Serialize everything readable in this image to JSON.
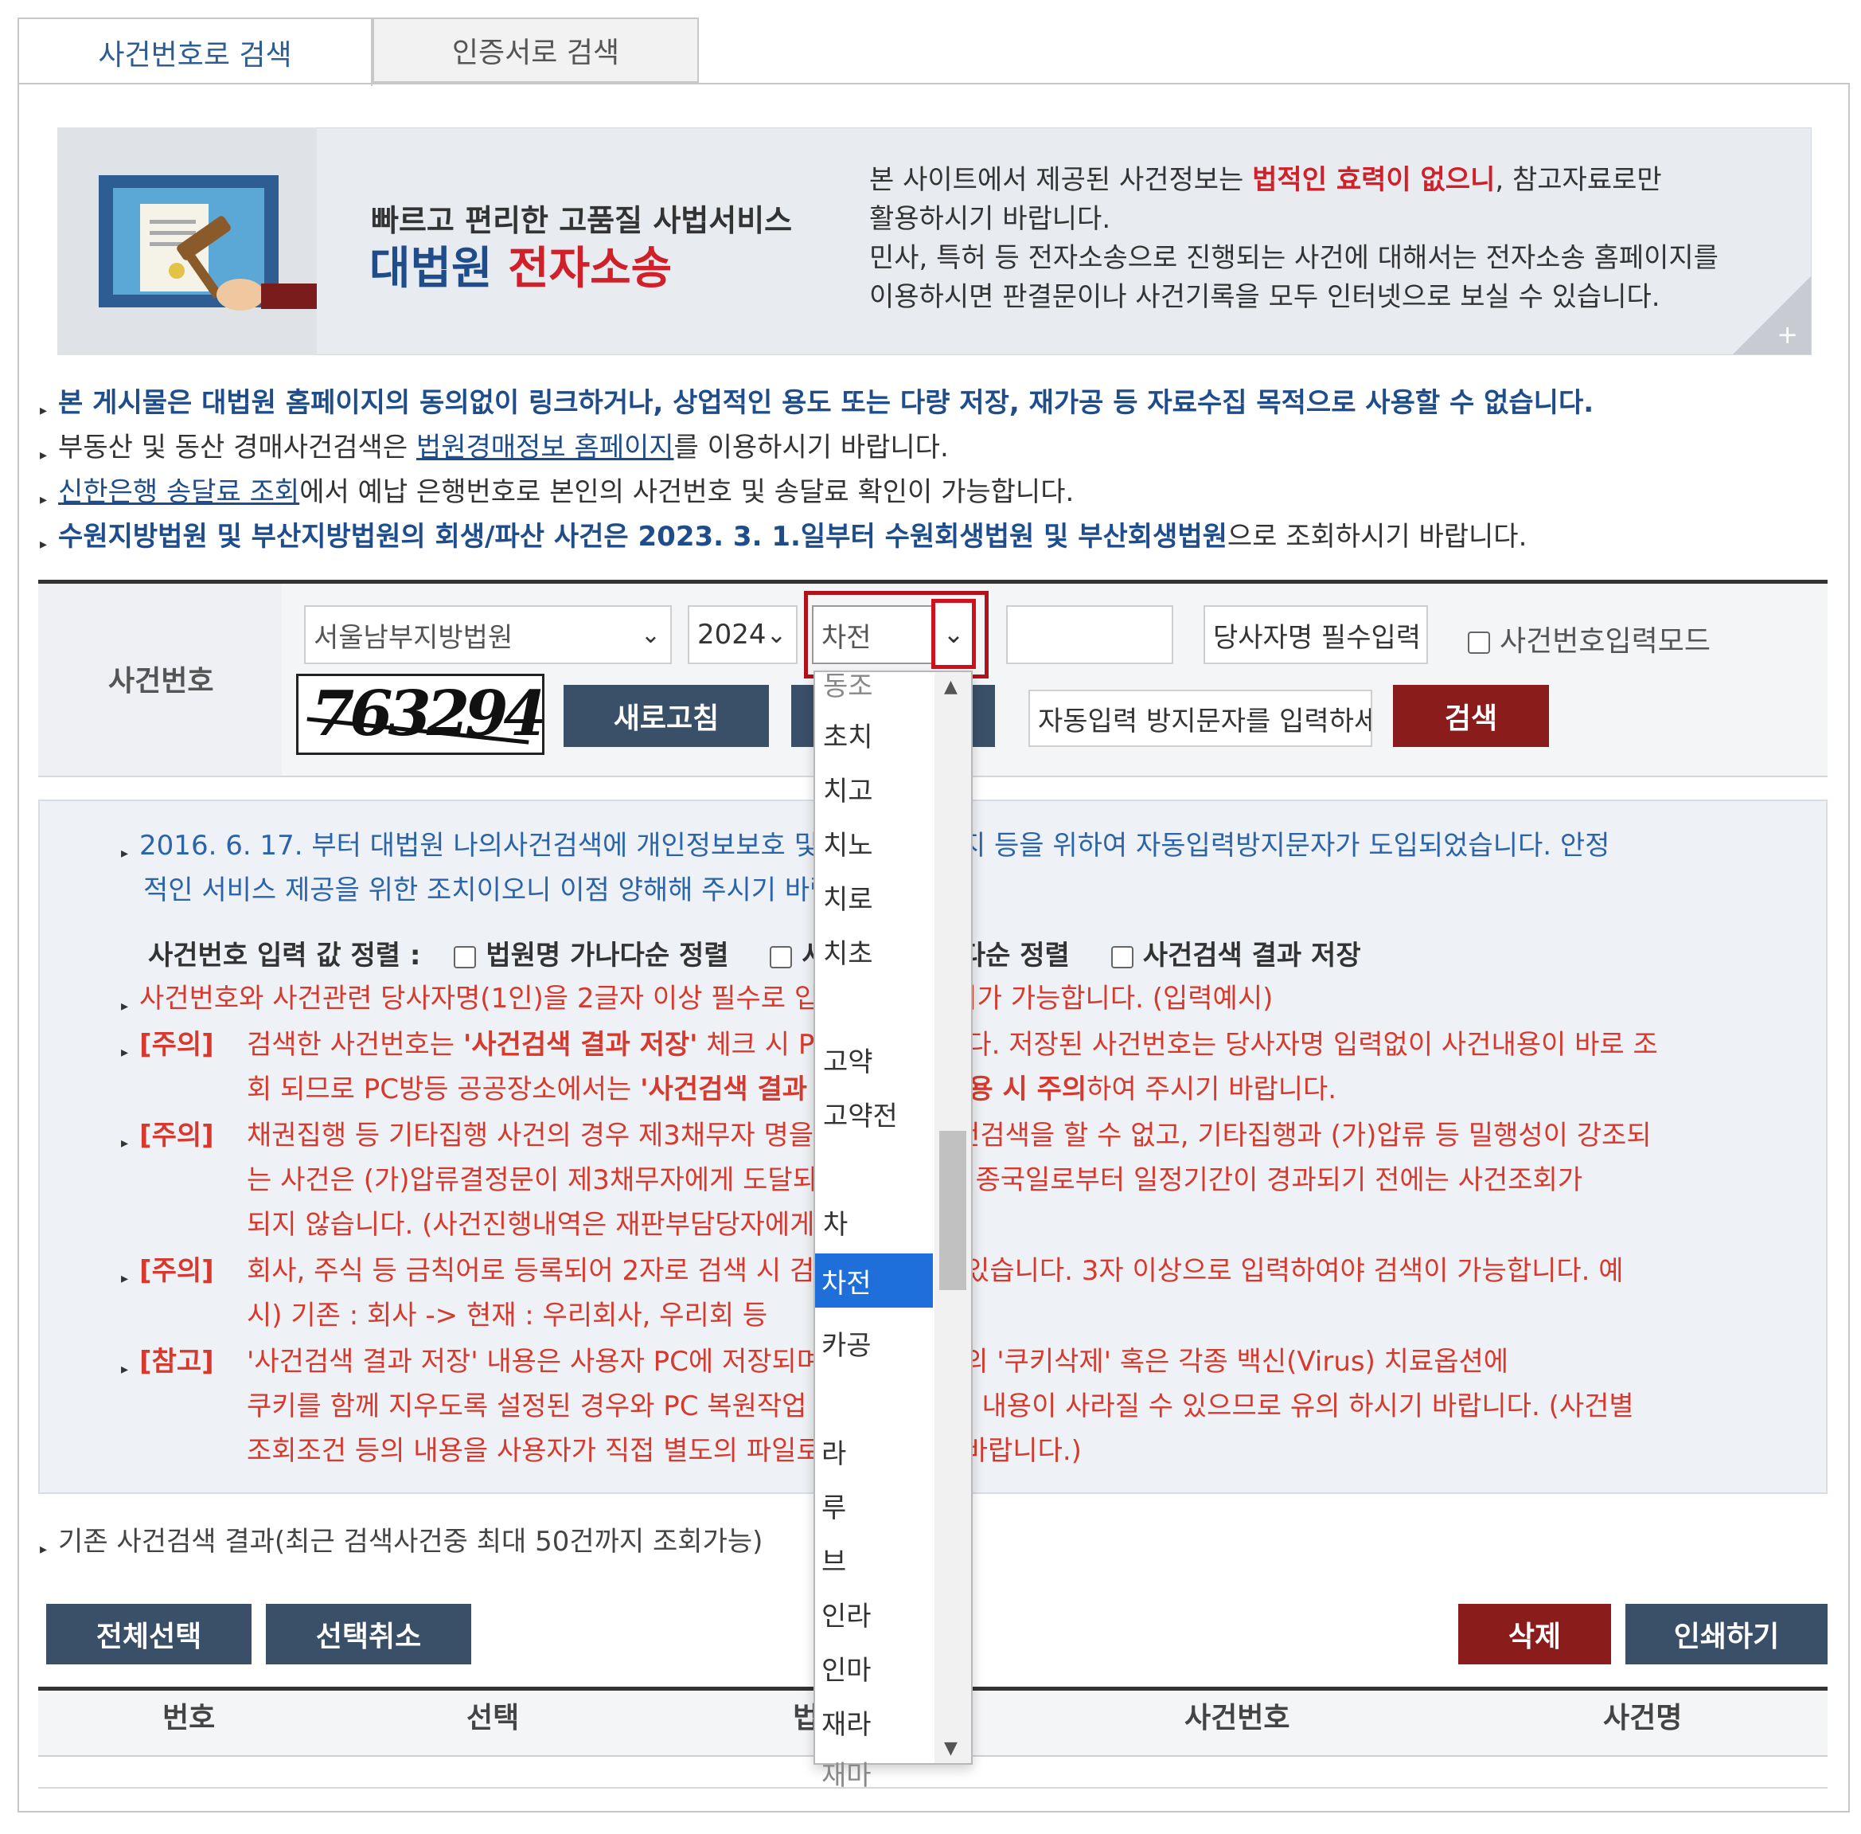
{
  "tabs": [
    {
      "label": "사건번호로 검색"
    },
    {
      "label": "인증서로 검색"
    }
  ],
  "banner": {
    "tagline": "빠르고 편리한 고품질 사법서비스",
    "brand_main": "대법원",
    "brand_accent": "전자소송",
    "text1_a": "본 사이트에서 제공된 사건정보는 ",
    "text1_red": "법적인 효력이 없으니",
    "text1_b": ", 참고자료로만",
    "text2": "활용하시기 바랍니다.",
    "text3": "민사, 특허 등 전자소송으로 진행되는 사건에 대해서는 전자소송 홈페이지를",
    "text4": "이용하시면 판결문이나 사건기록을 모두 인터넷으로 보실 수 있습니다.",
    "plus": "+"
  },
  "notices": {
    "n1": "본 게시물은 대법원 홈페이지의 동의없이 링크하거나, 상업적인 용도 또는 다량 저장, 재가공 등 자료수집 목적으로 사용할 수 없습니다.",
    "n2_a": "부동산 및 동산 경매사건검색은 ",
    "n2_link": "법원경매정보 홈페이지",
    "n2_b": "를 이용하시기 바랍니다.",
    "n3_link": "신한은행 송달료 조회",
    "n3_b": "에서 예납 은행번호로 본인의 사건번호 및 송달료 확인이 가능합니다.",
    "n4_a": "수원지방법원 및 부산지방법원의 회생/파산 사건은 2023. 3. 1.일부터 수원회생법원 및 부산회생법원",
    "n4_b": "으로 조회하시기 바랍니다."
  },
  "search": {
    "label": "사건번호",
    "court": "서울남부지방법원",
    "year": "2024",
    "case_type": "차전",
    "case_number": "",
    "party_placeholder": "당사자명 필수입력",
    "input_mode_label": "사건번호입력모드",
    "captcha_text": "763294",
    "refresh_label": "새로고침",
    "captcha_placeholder": "자동입력 방지문자를 입력하세요",
    "search_label": "검색"
  },
  "info": {
    "line1": "2016. 6. 17. 부터 대법원 나의사건검색에 개인정보보호 및 무단수집 방지 등을 위하여 자동입력방지문자가 도입되었습니다. 안정",
    "line2": "적인 서비스 제공을 위한 조치이오니 이점 양해해 주시기 바랍니다.",
    "sort_label": "사건번호 입력 값 정렬 :",
    "sort_opt1": "법원명 가나다순 정렬",
    "sort_opt2": "사건번호 가나다순 정렬",
    "sort_opt3": "사건검색 결과 저장",
    "red1": "사건번호와 사건관련 당사자명(1인)을 2글자 이상 필수로 입력하셔야 조회가 가능합니다. (입력예시)",
    "tag_note": "[주의]",
    "tag_ref": "[참고]",
    "c1_l1_a": "검색한 사건번호는 ",
    "c1_l1_b": "'사건검색 결과 저장'",
    "c1_l1_c": " 체크 시 PC에 저장됩니다. 저장된 사건번호는 당사자명 입력없이 사건내용이 바로 조",
    "c1_l2_a": "회 되므로 PC방등 공공장소에서는 ",
    "c1_l2_b": "'사건검색 결과 저장' 기능 사용 시 주의",
    "c1_l2_c": "하여 주시기 바랍니다.",
    "c2_l1": "채권집행 등 기타집행 사건의 경우 제3채무자 명을 입력하여 사건검색을 할 수 없고, 기타집행과 (가)압류 등 밀행성이 강조되",
    "c2_l2": "는 사건은 (가)압류결정문이 제3채무자에게 도달되었다거나 사건종국일로부터 일정기간이 경과되기 전에는 사건조회가",
    "c2_l3": "되지 않습니다. (사건진행내역은 재판부담당자에게 문의)",
    "c3_l1": "회사, 주식 등 금칙어로 등록되어 2자로 검색 시 검색이 안될 수 있습니다. 3자 이상으로 입력하여야 검색이 가능합니다. 예",
    "c3_l2": "시) 기존 : 회사 -> 현재 : 우리회사, 우리회 등",
    "c4_l1": "'사건검색 결과 저장' 내용은 사용자 PC에 저장되며 인터넷 옵션의 '쿠키삭제' 혹은 각종 백신(Virus) 치료옵션에",
    "c4_l2": "쿠키를 함께 지우도록 설정된 경우와 PC 복원작업 등으로 저장된 내용이 사라질 수 있으므로 유의 하시기 바랍니다. (사건별",
    "c4_l3": "조회조건 등의 내용을 사용자가 직접 별도의 파일로 관리하시기 바랍니다.)"
  },
  "history": {
    "title": "기존 사건검색 결과(최근 검색사건중 최대 50건까지 조회가능)",
    "select_all": "전체선택",
    "deselect": "선택취소",
    "delete": "삭제",
    "print": "인쇄하기",
    "columns": [
      "번호",
      "선택",
      "법원",
      "사건번호",
      "사건명"
    ]
  },
  "dropdown": {
    "options": [
      "동조",
      "초치",
      "치고",
      "치노",
      "치로",
      "치초",
      "",
      "고약",
      "고약전",
      "",
      "차",
      "차전",
      "카공",
      "",
      "라",
      "루",
      "브",
      "인라",
      "인마",
      "재라",
      "재마"
    ],
    "selected": "차전"
  },
  "colors": {
    "navy_button": "#3a5068",
    "red_button": "#8a1c1c",
    "highlight": "#1e6fd9",
    "notice_red": "#d63a2e",
    "notice_blue": "#2b64a8",
    "focus_box": "#b0121b"
  }
}
